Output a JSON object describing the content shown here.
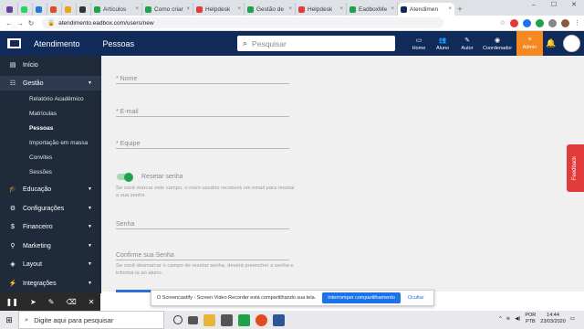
{
  "browser": {
    "tabs": [
      {
        "label": "",
        "color": "#6a3ea1"
      },
      {
        "label": "",
        "color": "#25d366"
      },
      {
        "label": "",
        "color": "#1f7ae0"
      },
      {
        "label": "",
        "color": "#e04b1f"
      },
      {
        "label": "",
        "color": "#e8a317"
      },
      {
        "label": "",
        "color": "#333333"
      },
      {
        "label": "Artículos",
        "color": "#1fa34a"
      },
      {
        "label": "Como criar",
        "color": "#1fa34a"
      },
      {
        "label": "Helpdesk",
        "color": "#e23b3b"
      },
      {
        "label": "Gestão de",
        "color": "#1fa34a"
      },
      {
        "label": "Helpdesk",
        "color": "#e23b3b"
      },
      {
        "label": "EadboxMe",
        "color": "#1fa34a"
      },
      {
        "label": "Atendimen",
        "color": "#102a5a",
        "active": true
      }
    ],
    "new_tab": "+",
    "window_controls": [
      "–",
      "☐",
      "✕"
    ],
    "url": "atendimento.eadbox.com/users/new"
  },
  "header": {
    "app_name": "Atendimento",
    "section": "Pessoas",
    "search_placeholder": "Pesquisar",
    "nav": [
      {
        "label": "Home",
        "icon": "home-icon",
        "glyph": "▭"
      },
      {
        "label": "Aluno",
        "icon": "students-icon",
        "glyph": "👥"
      },
      {
        "label": "Autor",
        "icon": "pen-icon",
        "glyph": "✎"
      },
      {
        "label": "Coordenador",
        "icon": "eye-icon",
        "glyph": "◉"
      },
      {
        "label": "Admin",
        "icon": "admin-icon",
        "glyph": "≡"
      }
    ],
    "accent": "#f5891f",
    "bg": "#102a5a"
  },
  "sidebar": {
    "items": [
      {
        "label": "Início",
        "glyph": "▤"
      },
      {
        "label": "Gestão",
        "glyph": "☷",
        "caret": true
      },
      {
        "label": "Educação",
        "glyph": "🎓",
        "caret": true
      },
      {
        "label": "Configurações",
        "glyph": "⚙",
        "caret": true
      },
      {
        "label": "Financeiro",
        "glyph": "$",
        "caret": true
      },
      {
        "label": "Marketing",
        "glyph": "⚲",
        "caret": true
      },
      {
        "label": "Layout",
        "glyph": "◈",
        "caret": true
      },
      {
        "label": "Integrações",
        "glyph": "⚡",
        "caret": true
      }
    ],
    "sub_items": [
      "Relatório Acadêmico",
      "Matrículas",
      "Pessoas",
      "Importação em massa",
      "Convites",
      "Sessões"
    ]
  },
  "form": {
    "name_label": "* Nome",
    "email_label": "* E-mail",
    "team_label": "* Equipe",
    "reset_label": "Resetar senha",
    "reset_help": "Se você marcar este campo, o novo usuário receberá um email para resetar a sua senha",
    "reset_enabled": true,
    "password_label": "Senha",
    "confirm_label": "Confirme sua Senha",
    "confirm_help": "Se você desmarcar o campo de resetar senha, deverá preencher a senha e informá-la ao aluno."
  },
  "feedback_label": "Feedback",
  "screencastify": {
    "message": "O Screencastify - Screen Video Recorder está compartilhando sua tela.",
    "stop_label": "Interromper compartilhamento",
    "hide_label": "Ocultar"
  },
  "taskbar": {
    "search_placeholder": "Digite aqui para pesquisar",
    "lang": "POR",
    "layout": "PTB",
    "time": "14:44",
    "date": "23/03/2020"
  }
}
